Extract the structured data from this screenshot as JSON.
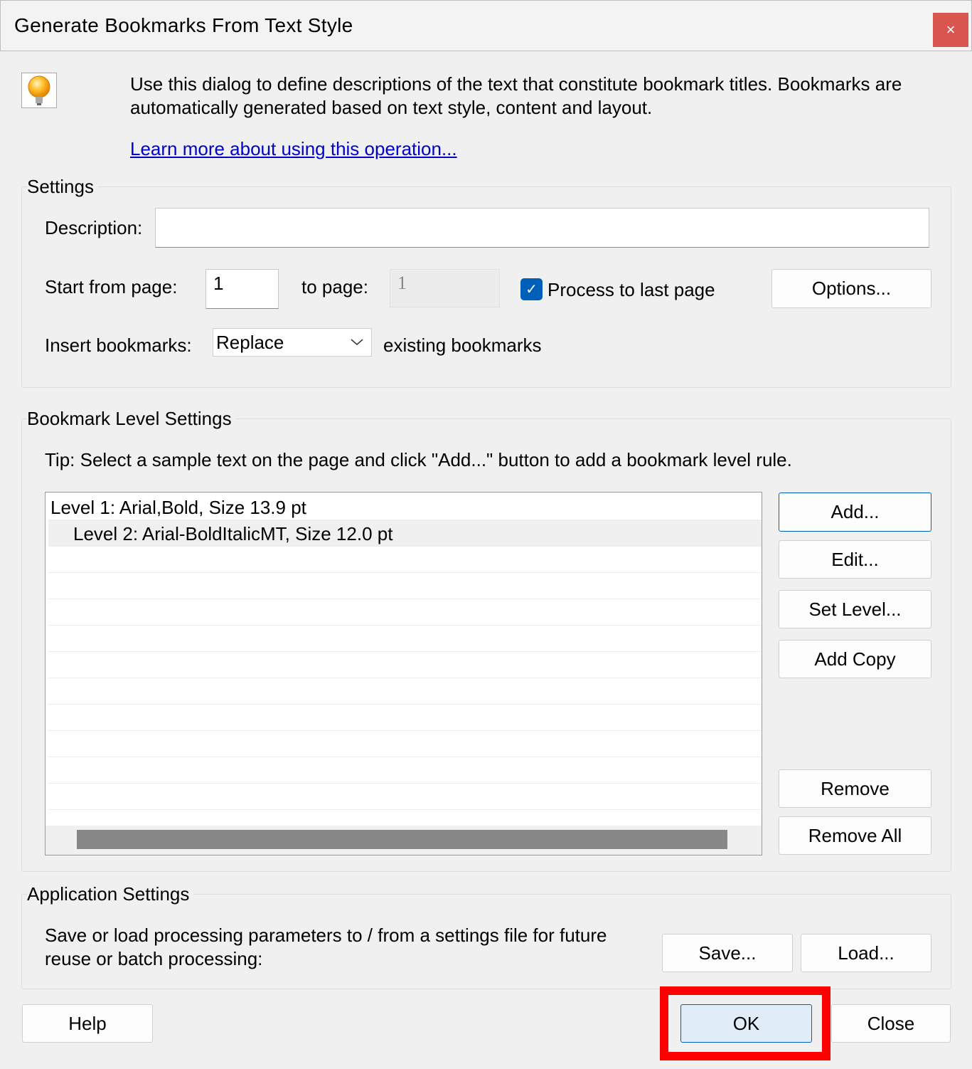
{
  "window": {
    "title": "Generate Bookmarks From Text Style",
    "close_label": "×"
  },
  "intro": {
    "icon": "lightbulb-icon",
    "line1": "Use this dialog to define descriptions of the text that constitute bookmark titles. Bookmarks are",
    "line2": "automatically generated based on text style, content and layout.",
    "link": "Learn more about using this operation..."
  },
  "settings": {
    "label": "Settings",
    "description_label": "Description:",
    "description_value": "",
    "start_label": "Start from page:",
    "start_value": "1",
    "to_label": "to page:",
    "to_value": "1",
    "process_last_label": "Process to last page",
    "process_last_checked": true,
    "options_button": "Options...",
    "insert_label": "Insert bookmarks:",
    "insert_value": "Replace",
    "insert_suffix": "existing bookmarks"
  },
  "levels": {
    "label": "Bookmark Level Settings",
    "tip": "Tip: Select a sample text on the page and click \"Add...\" button to add a bookmark level rule.",
    "rules": [
      "Level 1: Arial,Bold, Size 13.9 pt",
      "Level 2: Arial-BoldItalicMT, Size 12.0 pt"
    ],
    "buttons": {
      "add": "Add...",
      "edit": "Edit...",
      "set_level": "Set Level...",
      "add_copy": "Add Copy",
      "remove": "Remove",
      "remove_all": "Remove All"
    }
  },
  "app": {
    "label": "Application Settings",
    "text1": "Save or load processing parameters to / from a settings file for future",
    "text2": "reuse or batch processing:",
    "save": "Save...",
    "load": "Load..."
  },
  "footer": {
    "help": "Help",
    "ok": "OK",
    "close": "Close"
  },
  "colors": {
    "accent": "#005fb8",
    "highlight": "#ff0000",
    "close_bg": "#d85550"
  }
}
